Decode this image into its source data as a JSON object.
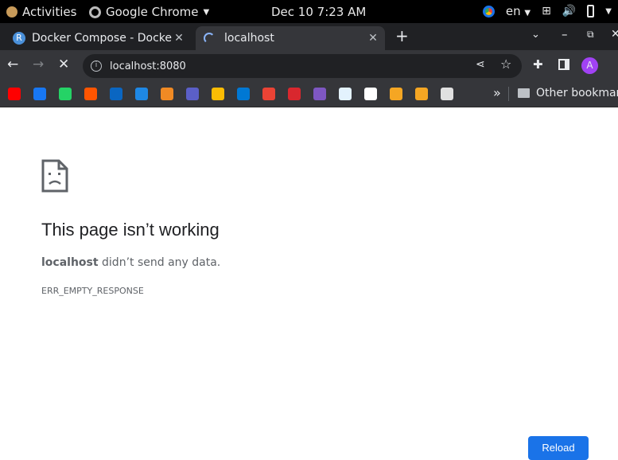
{
  "system_bar": {
    "activities": "Activities",
    "app_name": "Google Chrome",
    "clock": "Dec 10   7:23 AM",
    "language": "en"
  },
  "tabs": [
    {
      "label": "Docker Compose - Docker",
      "favicon": "R",
      "active": false
    },
    {
      "label": "localhost",
      "active": true
    }
  ],
  "omnibox": {
    "url": "localhost:8080"
  },
  "profile": {
    "initial": "A",
    "color": "#a142f4"
  },
  "bookmarks_bar": {
    "overflow": "»",
    "other": "Other bookmarks",
    "icons": [
      {
        "name": "youtube-icon",
        "color": "#ff0000"
      },
      {
        "name": "facebook-icon",
        "color": "#1877f2"
      },
      {
        "name": "whatsapp-icon",
        "color": "#25d366"
      },
      {
        "name": "soundcloud-icon",
        "color": "#ff5500"
      },
      {
        "name": "linkedin-icon",
        "color": "#0a66c2"
      },
      {
        "name": "globe-icon",
        "color": "#1e88e5"
      },
      {
        "name": "indeed-icon",
        "color": "#f08a24"
      },
      {
        "name": "teams-icon",
        "color": "#5b5fc7"
      },
      {
        "name": "drive-icon",
        "color": "#fbbc04"
      },
      {
        "name": "outlook-icon",
        "color": "#0078d4"
      },
      {
        "name": "gmail-icon",
        "color": "#ea4335"
      },
      {
        "name": "mega-icon",
        "color": "#d9272e"
      },
      {
        "name": "power-automate-icon",
        "color": "#7e57c2"
      },
      {
        "name": "chart-app-icon",
        "color": "#e3f2fd"
      },
      {
        "name": "google-icon",
        "color": "#ffffff"
      },
      {
        "name": "loop-icon",
        "color": "#f5a623"
      },
      {
        "name": "loop2-icon",
        "color": "#f5a623"
      },
      {
        "name": "draw-icon",
        "color": "#e0e0e0"
      }
    ]
  },
  "error_page": {
    "title": "This page isn’t working",
    "host": "localhost",
    "desc": " didn’t send any data.",
    "code": "ERR_EMPTY_RESPONSE",
    "reload": "Reload"
  }
}
